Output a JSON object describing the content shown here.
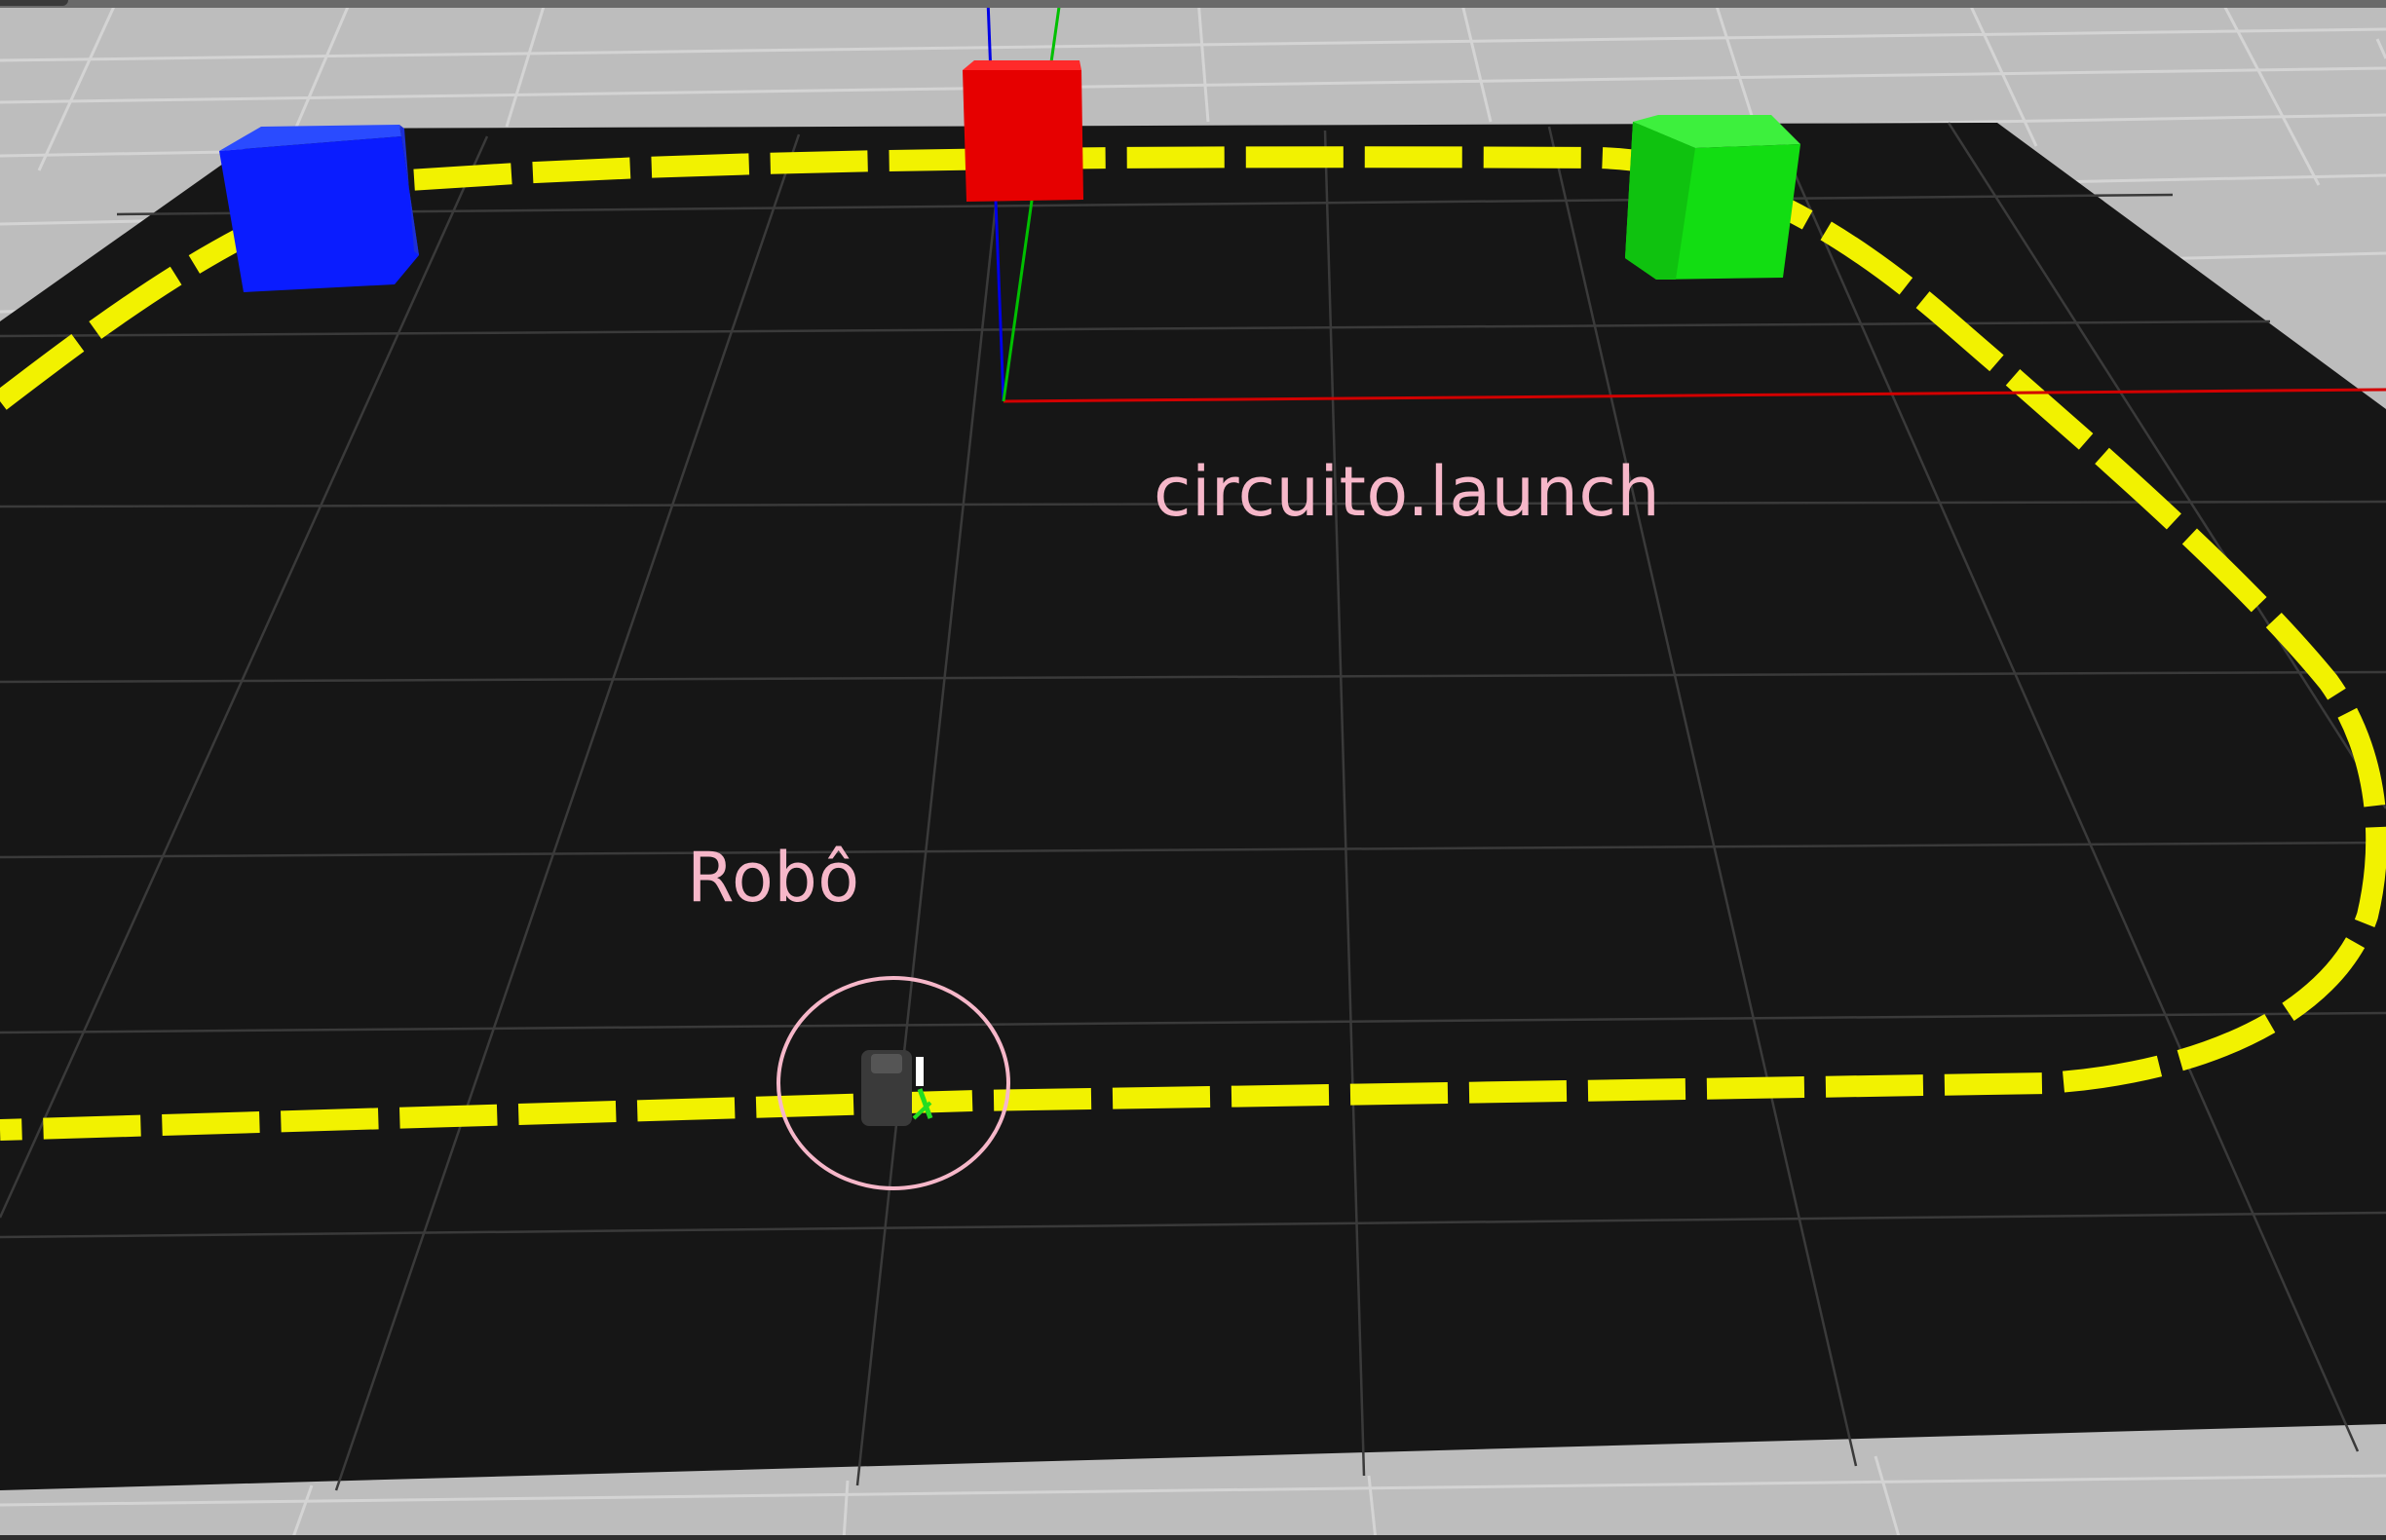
{
  "viewport": {
    "name": "3D simulation viewport"
  },
  "labels": {
    "launch_file": "circuito.launch",
    "robot": "Robô"
  },
  "colors": {
    "sky_background": "#bdbdbd",
    "ground_grid": "#d0d0d0",
    "arena_floor": "#161616",
    "arena_grid": "#3c3c3c",
    "track_line": "#f2f200",
    "annotation": "#f6b7c9",
    "cube_blue": "#0a1cff",
    "cube_red": "#e60000",
    "cube_green": "#12dd12",
    "axis_x": "#d20000",
    "axis_y": "#00c000",
    "axis_z": "#0000e6"
  },
  "objects": [
    {
      "kind": "cube",
      "color": "blue",
      "icon": "blue-cube-icon"
    },
    {
      "kind": "cube",
      "color": "red",
      "icon": "red-cube-icon"
    },
    {
      "kind": "cube",
      "color": "green",
      "icon": "green-cube-icon"
    },
    {
      "kind": "robot",
      "icon": "robot-icon"
    },
    {
      "kind": "origin-axes",
      "icon": "axes-icon"
    }
  ]
}
